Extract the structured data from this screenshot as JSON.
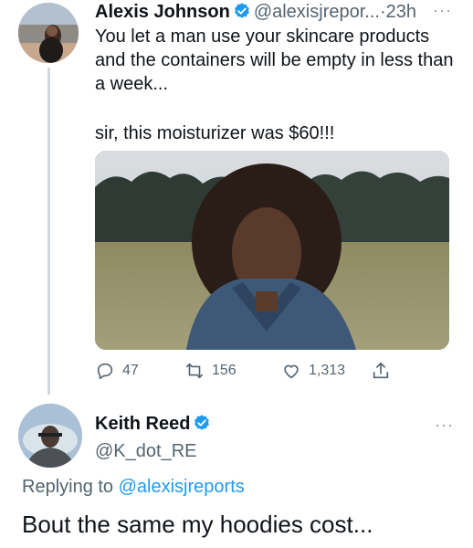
{
  "tweet": {
    "author_name": "Alexis Johnson",
    "handle": "@alexisjrepor...",
    "separator": "·",
    "time": "23h",
    "more": "···",
    "text_line1": "You let a man use your skincare products and the containers will be empty in less than a week...",
    "text_line2": "sir, this moisturizer was $60!!!",
    "media_icon": "photo",
    "actions": {
      "reply_count": "47",
      "retweet_count": "156",
      "like_count": "1,313"
    }
  },
  "reply": {
    "author_name": "Keith Reed",
    "handle": "@K_dot_RE",
    "more": "···",
    "replying_prefix": "Replying to",
    "replying_to": "@alexisjreports",
    "text": "Bout the same my hoodies cost..."
  },
  "colors": {
    "verified": "#1d9bf0",
    "link": "#1d9bf0",
    "secondary_text": "#536471"
  }
}
